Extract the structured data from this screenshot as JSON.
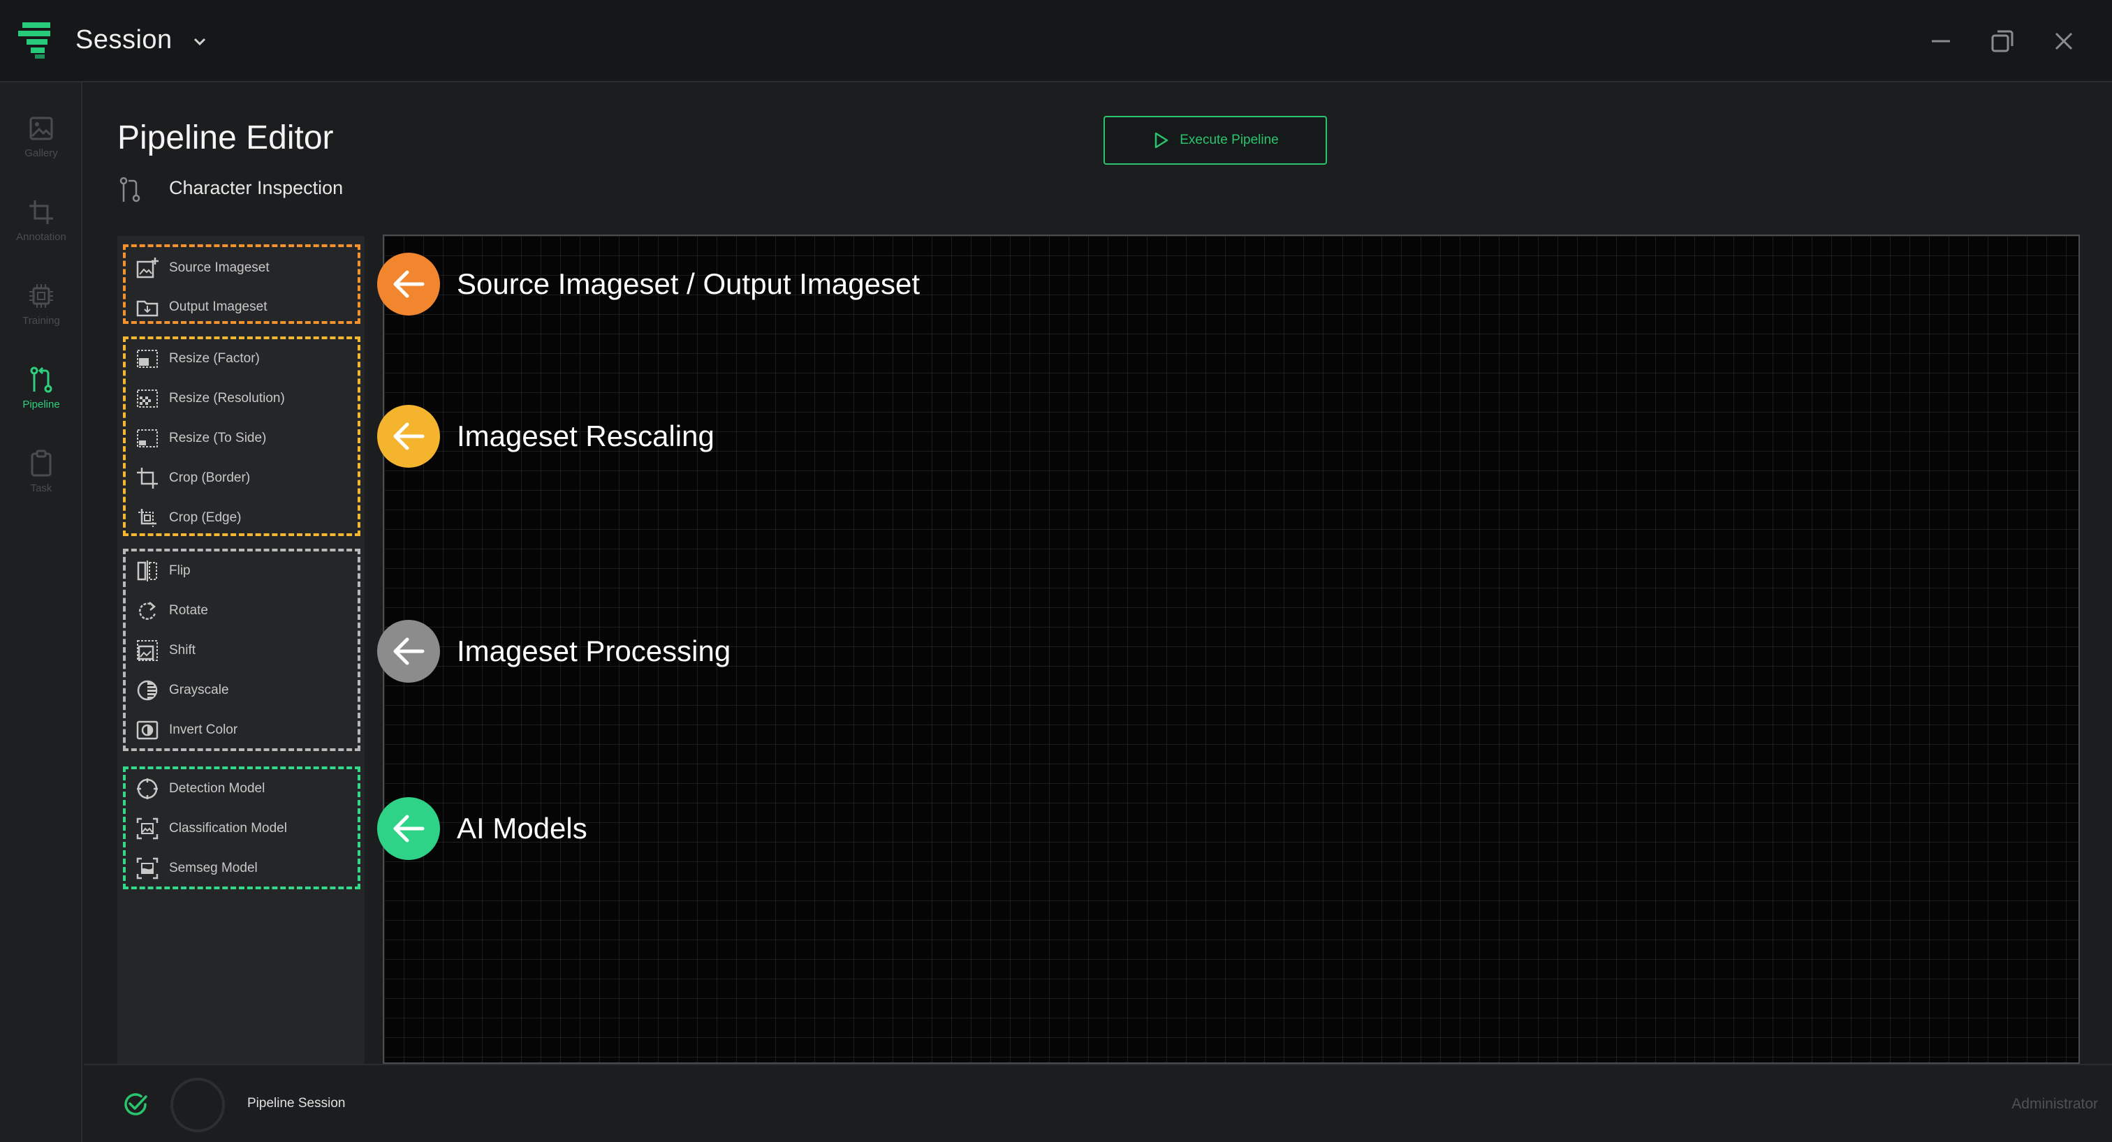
{
  "titlebar": {
    "title": "Session"
  },
  "nav": {
    "items": [
      {
        "label": "Gallery",
        "icon": "image-icon"
      },
      {
        "label": "Annotation",
        "icon": "crop-icon"
      },
      {
        "label": "Training",
        "icon": "chip-icon"
      },
      {
        "label": "Pipeline",
        "icon": "pipeline-icon",
        "active": true
      },
      {
        "label": "Task",
        "icon": "clipboard-icon"
      }
    ]
  },
  "header": {
    "title": "Pipeline Editor",
    "breadcrumb": "Character Inspection",
    "execute_label": "Execute Pipeline"
  },
  "palette": {
    "source": [
      {
        "label": "Source Imageset",
        "icon": "image-add-icon"
      },
      {
        "label": "Output Imageset",
        "icon": "folder-out-icon"
      }
    ],
    "rescale": [
      {
        "label": "Resize (Factor)",
        "icon": "resize-factor-icon"
      },
      {
        "label": "Resize (Resolution)",
        "icon": "resize-resolution-icon"
      },
      {
        "label": "Resize (To Side)",
        "icon": "resize-side-icon"
      },
      {
        "label": "Crop (Border)",
        "icon": "crop-border-icon"
      },
      {
        "label": "Crop (Edge)",
        "icon": "crop-edge-icon"
      }
    ],
    "processing": [
      {
        "label": "Flip",
        "icon": "flip-icon"
      },
      {
        "label": "Rotate",
        "icon": "rotate-icon"
      },
      {
        "label": "Shift",
        "icon": "shift-icon"
      },
      {
        "label": "Grayscale",
        "icon": "grayscale-icon"
      },
      {
        "label": "Invert Color",
        "icon": "invert-icon"
      }
    ],
    "ai": [
      {
        "label": "Detection Model",
        "icon": "detection-icon"
      },
      {
        "label": "Classification Model",
        "icon": "classification-icon"
      },
      {
        "label": "Semseg Model",
        "icon": "semseg-icon"
      }
    ]
  },
  "annotations": [
    {
      "text": "Source Imageset / Output Imageset",
      "color": "#f2862f"
    },
    {
      "text": "Imageset Rescaling",
      "color": "#f5b42e"
    },
    {
      "text": "Imageset Processing",
      "color": "#8c8c8c"
    },
    {
      "text": "AI Models",
      "color": "#2fd387"
    }
  ],
  "status": {
    "session": "Pipeline Session",
    "user": "Administrator"
  },
  "colors": {
    "accent": "#2bc46e",
    "background": "#1b1d1f",
    "canvas": "#050505"
  }
}
